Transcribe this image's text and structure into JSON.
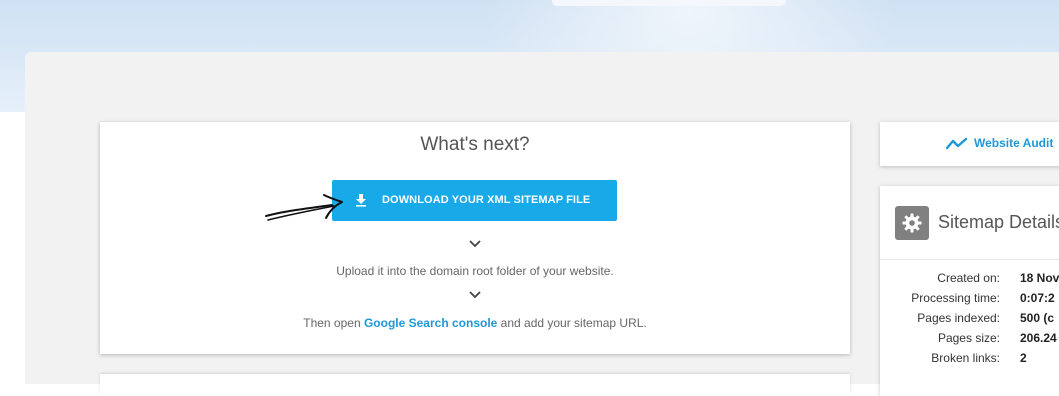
{
  "next_steps": {
    "title": "What's next?",
    "download_button": {
      "label": "DOWNLOAD YOUR XML SITEMAP FILE",
      "icon": "download-icon"
    },
    "step_upload": "Upload it into the domain root folder of your website.",
    "step_open_prefix": "Then open ",
    "step_open_link": "Google Search console",
    "step_open_suffix": " and add your sitemap URL."
  },
  "sidebar": {
    "audit_link": {
      "label": "Website Audit",
      "icon": "trend-line-icon"
    },
    "details": {
      "title": "Sitemap Details",
      "icon": "gear-icon",
      "rows": [
        {
          "label": "Created on:",
          "value": "18 Nov"
        },
        {
          "label": "Processing time:",
          "value": "0:07:2"
        },
        {
          "label": "Pages indexed:",
          "value": "500 (c"
        },
        {
          "label": "Pages size:",
          "value": "206.24"
        },
        {
          "label": "Broken links:",
          "value": "2"
        }
      ]
    }
  },
  "colors": {
    "accent": "#17a9e8",
    "link": "#1e98d7",
    "panel_bg": "#f2f2f2"
  }
}
